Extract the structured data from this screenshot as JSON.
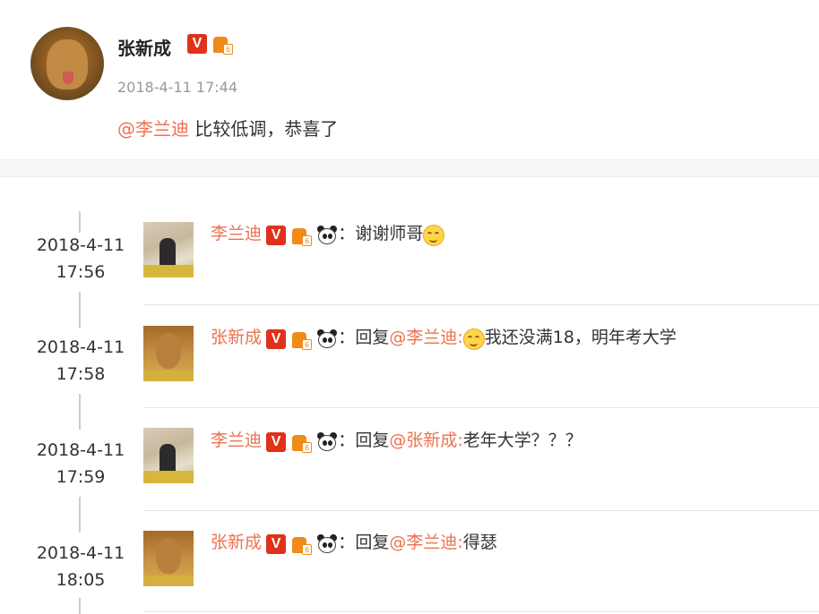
{
  "post": {
    "author": "张新成",
    "date": "2018-4-11 17:44",
    "mention": "@李兰迪",
    "text": " 比较低调，恭喜了"
  },
  "badges": {
    "verified": "V",
    "member": "6"
  },
  "comments": [
    {
      "date": "2018-4-11",
      "time": "17:56",
      "author": "李兰迪",
      "avatar": "girl-avatar",
      "sep": "：",
      "reply_prefix": "",
      "reply_mention": "",
      "text": "谢谢师哥",
      "emoji_after": "smile-emoji",
      "emoji_before": ""
    },
    {
      "date": "2018-4-11",
      "time": "17:58",
      "author": "张新成",
      "avatar": "dog-avatar",
      "sep": "：",
      "reply_prefix": "回复",
      "reply_mention": "@李兰迪:",
      "text": "我还没满18，明年考大学",
      "emoji_after": "",
      "emoji_before": "smirk-emoji"
    },
    {
      "date": "2018-4-11",
      "time": "17:59",
      "author": "李兰迪",
      "avatar": "girl-avatar",
      "sep": "：",
      "reply_prefix": "回复",
      "reply_mention": "@张新成:",
      "text": "老年大学？？？",
      "emoji_after": "",
      "emoji_before": ""
    },
    {
      "date": "2018-4-11",
      "time": "18:05",
      "author": "张新成",
      "avatar": "dog-avatar",
      "sep": "：",
      "reply_prefix": "回复",
      "reply_mention": "@李兰迪:",
      "text": "得瑟",
      "emoji_after": "",
      "emoji_before": ""
    }
  ]
}
